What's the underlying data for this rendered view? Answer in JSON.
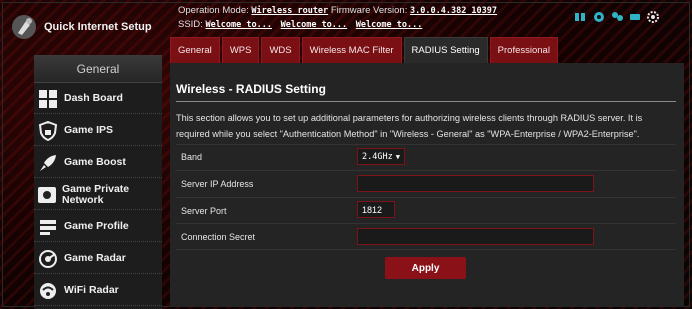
{
  "quick_setup": {
    "label": "Quick Internet Setup"
  },
  "sidebar": {
    "header": "General",
    "items": [
      {
        "label": "Dash Board",
        "icon": "dashboard-icon"
      },
      {
        "label": "Game IPS",
        "icon": "shield-lock-icon"
      },
      {
        "label": "Game Boost",
        "icon": "rocket-icon"
      },
      {
        "label": "Game Private Network",
        "icon": "network-icon"
      },
      {
        "label": "Game Profile",
        "icon": "profile-icon"
      },
      {
        "label": "Game Radar",
        "icon": "radar-icon"
      },
      {
        "label": "WiFi Radar",
        "icon": "wifi-radar-icon"
      }
    ]
  },
  "header": {
    "operation_mode_label": "Operation Mode:",
    "operation_mode_value": "Wireless router",
    "firmware_label": "Firmware Version:",
    "firmware_value": "3.0.0.4.382_10397",
    "ssid_label": "SSID:",
    "ssids": [
      "Welcome to...",
      "Welcome to...",
      "Welcome to..."
    ],
    "status_icons": [
      "network-status-icon",
      "settings-status-icon",
      "clients-status-icon",
      "usb-status-icon",
      "gear-status-icon"
    ]
  },
  "tabs": [
    {
      "label": "General",
      "active": false
    },
    {
      "label": "WPS",
      "active": false
    },
    {
      "label": "WDS",
      "active": false
    },
    {
      "label": "Wireless MAC Filter",
      "active": false
    },
    {
      "label": "RADIUS Setting",
      "active": true
    },
    {
      "label": "Professional",
      "active": false
    }
  ],
  "main": {
    "title": "Wireless - RADIUS Setting",
    "description": "This section allows you to set up additional parameters for authorizing wireless clients through RADIUS server. It is required while you select \"Authentication Method\" in \"Wireless - General\" as \"WPA-Enterprise / WPA2-Enterprise\".",
    "fields": {
      "band": {
        "label": "Band",
        "value": "2.4GHz",
        "options": [
          "2.4GHz"
        ]
      },
      "server_ip": {
        "label": "Server IP Address",
        "value": ""
      },
      "server_port": {
        "label": "Server Port",
        "value": "1812"
      },
      "connection_secret": {
        "label": "Connection Secret",
        "value": ""
      }
    },
    "apply_label": "Apply"
  },
  "colors": {
    "accent": "#8a1118",
    "tab": "#7a0f14",
    "panel": "#242424"
  }
}
